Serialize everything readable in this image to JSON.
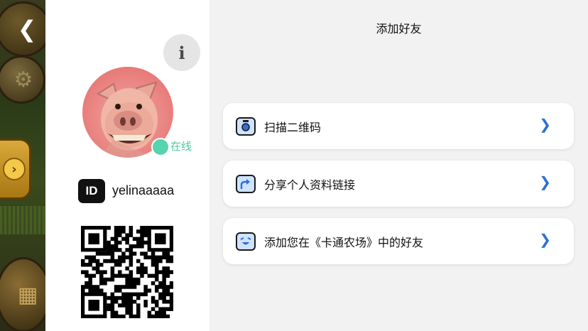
{
  "game_strip": {
    "back_icon": "chevron-left-icon",
    "settings_icon": "gear-icon",
    "shop_icon": "coin-arrow-icon",
    "cash_icon": "cash-register-icon"
  },
  "profile": {
    "info_label": "i",
    "status": "在线",
    "id_badge": "ID",
    "username": "yelinaaaaa",
    "colors": {
      "online": "#56d4ad"
    }
  },
  "main": {
    "title": "添加好友",
    "options": [
      {
        "label": "扫描二维码",
        "icon": "camera-icon"
      },
      {
        "label": "分享个人资料链接",
        "icon": "share-icon"
      },
      {
        "label": "添加您在《卡通农场》中的好友",
        "icon": "smiley-icon"
      }
    ],
    "accent": "#2e6fd8"
  }
}
